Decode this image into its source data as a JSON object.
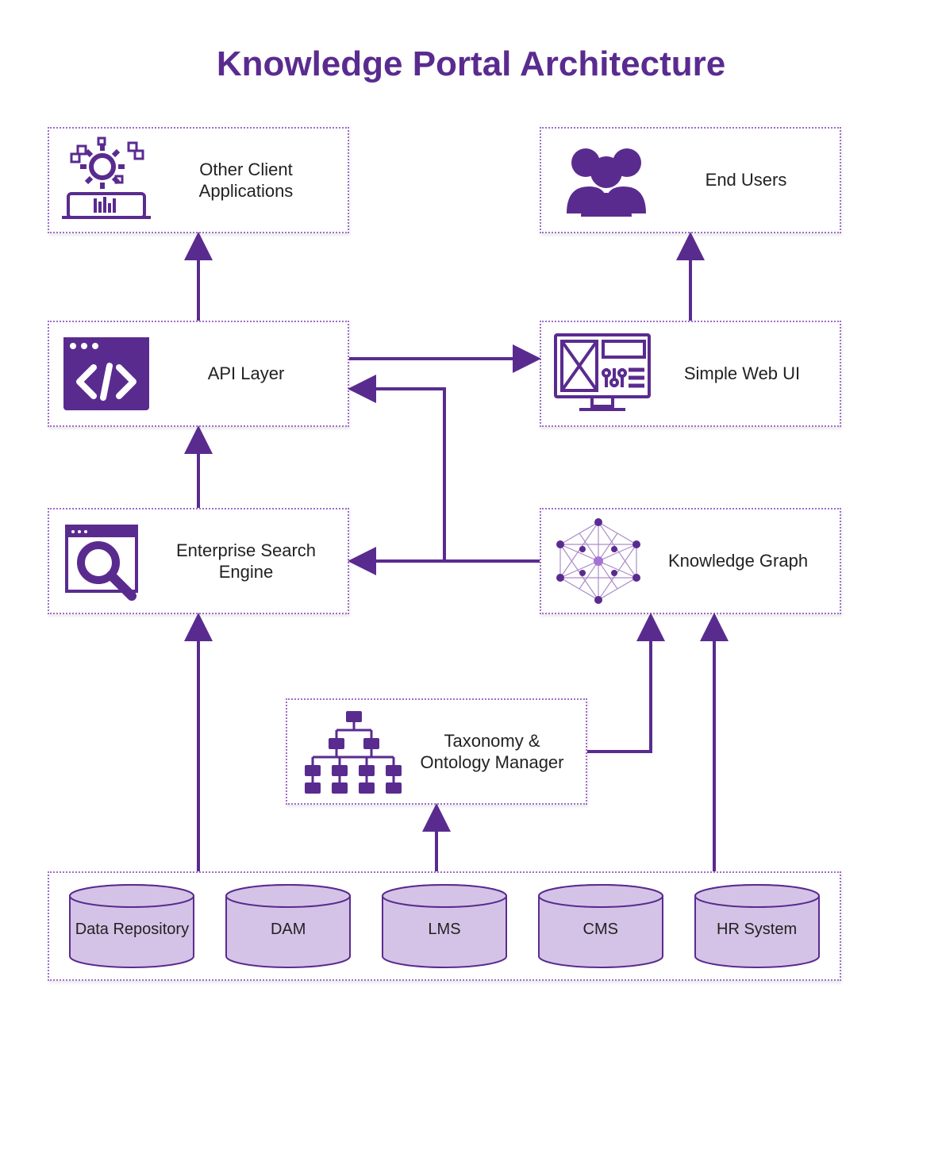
{
  "title": "Knowledge Portal Architecture",
  "colors": {
    "primary": "#5a2b8f",
    "accent": "#8038b8",
    "fill": "#d4c3e6"
  },
  "nodes": {
    "other_client": {
      "label": "Other Client Applications",
      "icon": "gear-process-icon"
    },
    "end_users": {
      "label": "End Users",
      "icon": "users-icon"
    },
    "api_layer": {
      "label": "API Layer",
      "icon": "code-window-icon"
    },
    "web_ui": {
      "label": "Simple Web UI",
      "icon": "monitor-ui-icon"
    },
    "search": {
      "label": "Enterprise Search Engine",
      "icon": "search-icon"
    },
    "kg": {
      "label": "Knowledge Graph",
      "icon": "network-graph-icon"
    },
    "taxo": {
      "label": "Taxonomy & Ontology Manager",
      "icon": "hierarchy-icon"
    }
  },
  "datasources": [
    {
      "label": "Data Repository"
    },
    {
      "label": "DAM"
    },
    {
      "label": "LMS"
    },
    {
      "label": "CMS"
    },
    {
      "label": "HR System"
    }
  ],
  "edges": [
    {
      "from": "api_layer",
      "to": "other_client"
    },
    {
      "from": "web_ui",
      "to": "end_users"
    },
    {
      "from": "api_layer",
      "to": "web_ui"
    },
    {
      "from": "search",
      "to": "api_layer"
    },
    {
      "from": "kg",
      "to": "api_layer"
    },
    {
      "from": "kg",
      "to": "search"
    },
    {
      "from": "taxo",
      "to": "kg"
    },
    {
      "from": "datasources",
      "to": "search"
    },
    {
      "from": "datasources",
      "to": "taxo"
    },
    {
      "from": "datasources",
      "to": "kg"
    }
  ]
}
